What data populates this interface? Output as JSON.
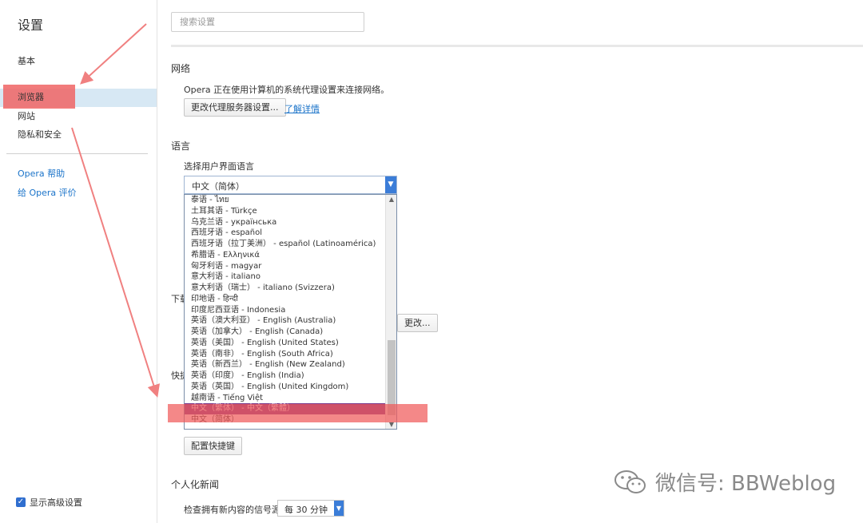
{
  "sidebar": {
    "title": "设置",
    "items": [
      {
        "label": "基本"
      },
      {
        "label": "浏览器"
      },
      {
        "label": "网站"
      },
      {
        "label": "隐私和安全"
      }
    ],
    "help_link": "Opera 帮助",
    "rate_link": "给 Opera 评价",
    "advanced_label": "显示高级设置",
    "advanced_checked": true
  },
  "search": {
    "placeholder": "搜索设置",
    "value": ""
  },
  "network": {
    "title": "网络",
    "description": "Opera 正在使用计算机的系统代理设置来连接网络。",
    "proxy_button": "更改代理服务器设置...",
    "learn_more": "了解详情"
  },
  "language": {
    "title": "语言",
    "select_label": "选择用户界面语言",
    "selected": "中文（简体）",
    "options": [
      "泰语 - ไทย",
      "土耳其语 - Türkçe",
      "乌克兰语 - українська",
      "西班牙语 - español",
      "西班牙语（拉丁美洲） - español (Latinoamérica)",
      "希腊语 - Ελληνικά",
      "匈牙利语 - magyar",
      "意大利语 - italiano",
      "意大利语（瑞士） - italiano (Svizzera)",
      "印地语 - हिन्दी",
      "印度尼西亚语 - Indonesia",
      "英语（澳大利亚） - English (Australia)",
      "英语（加拿大） - English (Canada)",
      "英语（美国） - English (United States)",
      "英语（南非） - English (South Africa)",
      "英语（新西兰） - English (New Zealand)",
      "英语（印度） - English (India)",
      "英语（英国） - English (United Kingdom)",
      "越南语 - Tiếng Việt",
      "中文（繁体） - 中文（繁體）",
      "中文（简体）"
    ],
    "highlighted": "中文（繁体） - 中文（繁體）"
  },
  "downloads": {
    "title_peek": "下载",
    "change_button": "更改..."
  },
  "shortcuts": {
    "title_peek": "快捷",
    "configure_button": "配置快捷键"
  },
  "news": {
    "title": "个人化新闻",
    "check_label": "检查拥有新内容的信号源",
    "interval": "每 30 分钟"
  },
  "watermark": {
    "text": "微信号: BBWeblog"
  },
  "colors": {
    "accent": "#3b7dd8",
    "selection": "#7b3c8c",
    "annotation": "#f06464",
    "link": "#1a73c9"
  },
  "icons": {
    "dropdown": "chevron-down-icon",
    "check": "check-icon",
    "wechat": "wechat-icon"
  }
}
